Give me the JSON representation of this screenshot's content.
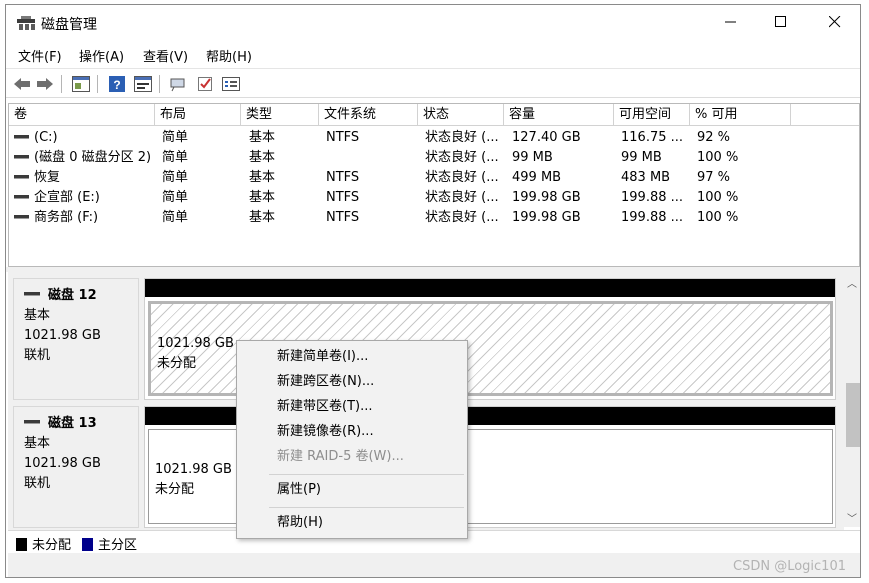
{
  "window": {
    "title": "磁盘管理",
    "controls": {
      "minimize": "—",
      "maximize": "☐",
      "close": "✕"
    }
  },
  "menu": [
    "文件(F)",
    "操作(A)",
    "查看(V)",
    "帮助(H)"
  ],
  "toolbar_icons": [
    "back-arrow-icon",
    "forward-arrow-icon",
    "volume-view-icon",
    "help-icon",
    "disk-view-icon",
    "connect-icon",
    "check-icon",
    "properties-icon"
  ],
  "volume_table": {
    "columns": [
      "卷",
      "布局",
      "类型",
      "文件系统",
      "状态",
      "容量",
      "可用空间",
      "% 可用"
    ],
    "rows": [
      [
        "(C:)",
        "简单",
        "基本",
        "NTFS",
        "状态良好 (...",
        "127.40 GB",
        "116.75 ...",
        "92 %"
      ],
      [
        "(磁盘 0 磁盘分区 2)",
        "简单",
        "基本",
        "",
        "状态良好 (...",
        "99 MB",
        "99 MB",
        "100 %"
      ],
      [
        "恢复",
        "简单",
        "基本",
        "NTFS",
        "状态良好 (...",
        "499 MB",
        "483 MB",
        "97 %"
      ],
      [
        "企宣部 (E:)",
        "简单",
        "基本",
        "NTFS",
        "状态良好 (...",
        "199.98 GB",
        "199.88 ...",
        "100 %"
      ],
      [
        "商务部 (F:)",
        "简单",
        "基本",
        "NTFS",
        "状态良好 (...",
        "199.98 GB",
        "199.88 ...",
        "100 %"
      ]
    ]
  },
  "disks": [
    {
      "name": "磁盘 12",
      "type": "基本",
      "size": "1021.98 GB",
      "status": "联机",
      "partition_size": "1021.98 GB",
      "partition_state": "未分配"
    },
    {
      "name": "磁盘 13",
      "type": "基本",
      "size": "1021.98 GB",
      "status": "联机",
      "partition_size": "1021.98 GB",
      "partition_state": "未分配"
    }
  ],
  "legend": [
    {
      "label": "未分配",
      "color": "#000000"
    },
    {
      "label": "主分区",
      "color": "#00008b"
    }
  ],
  "context_menu": {
    "items": [
      "新建简单卷(I)...",
      "新建跨区卷(N)...",
      "新建带区卷(T)...",
      "新建镜像卷(R)...",
      "新建 RAID-5 卷(W)..."
    ],
    "disabled_item": "新建 RAID-5 卷(W)...",
    "properties": "属性(P)",
    "help": "帮助(H)"
  },
  "watermark": "CSDN @Logic101"
}
